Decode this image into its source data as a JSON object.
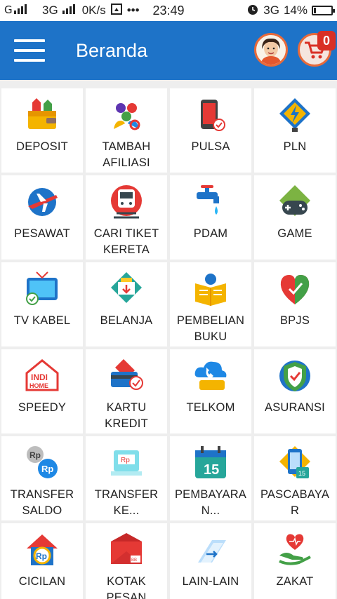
{
  "status_bar": {
    "signal1": "G",
    "signal2": "3G",
    "net_speed": "0K/s",
    "time": "23:49",
    "net2": "3G",
    "battery": "14%",
    "battery_level": 0.14
  },
  "app_bar": {
    "title": "Beranda",
    "cart_badge": "0"
  },
  "colors": {
    "app_bar": "#1e73c8",
    "badge": "#d93025",
    "ring": "#e86a3a"
  },
  "menu": [
    {
      "label": "DEPOSIT",
      "icon": "wallet-icon"
    },
    {
      "label": "TAMBAH AFILIASI",
      "icon": "people-icon"
    },
    {
      "label": "PULSA",
      "icon": "phone-icon"
    },
    {
      "label": "PLN",
      "icon": "lightning-icon"
    },
    {
      "label": "PESAWAT",
      "icon": "airplane-icon"
    },
    {
      "label": "CARI TIKET KERETA",
      "icon": "train-icon"
    },
    {
      "label": "PDAM",
      "icon": "water-tap-icon"
    },
    {
      "label": "GAME",
      "icon": "gamepad-icon"
    },
    {
      "label": "TV KABEL",
      "icon": "tv-icon"
    },
    {
      "label": "BELANJA",
      "icon": "shopping-icon"
    },
    {
      "label": "PEMBELIAN BUKU",
      "icon": "book-icon"
    },
    {
      "label": "BPJS",
      "icon": "heart-shield-icon"
    },
    {
      "label": "SPEEDY",
      "icon": "indihome-icon"
    },
    {
      "label": "KARTU KREDIT",
      "icon": "credit-card-icon"
    },
    {
      "label": "TELKOM",
      "icon": "cloud-phone-icon"
    },
    {
      "label": "ASURANSI",
      "icon": "shield-icon"
    },
    {
      "label": "TRANSFER SALDO",
      "icon": "coins-transfer-icon"
    },
    {
      "label": "TRANSFER KE...",
      "icon": "bank-transfer-icon"
    },
    {
      "label": "PEMBAYARA N...",
      "icon": "calendar-icon"
    },
    {
      "label": "PASCABAYA R",
      "icon": "postpaid-phone-icon"
    },
    {
      "label": "CICILAN",
      "icon": "house-coin-icon"
    },
    {
      "label": "KOTAK PESAN",
      "icon": "envelope-icon"
    },
    {
      "label": "LAIN-LAIN",
      "icon": "arrow-card-icon"
    },
    {
      "label": "ZAKAT",
      "icon": "charity-icon"
    }
  ]
}
